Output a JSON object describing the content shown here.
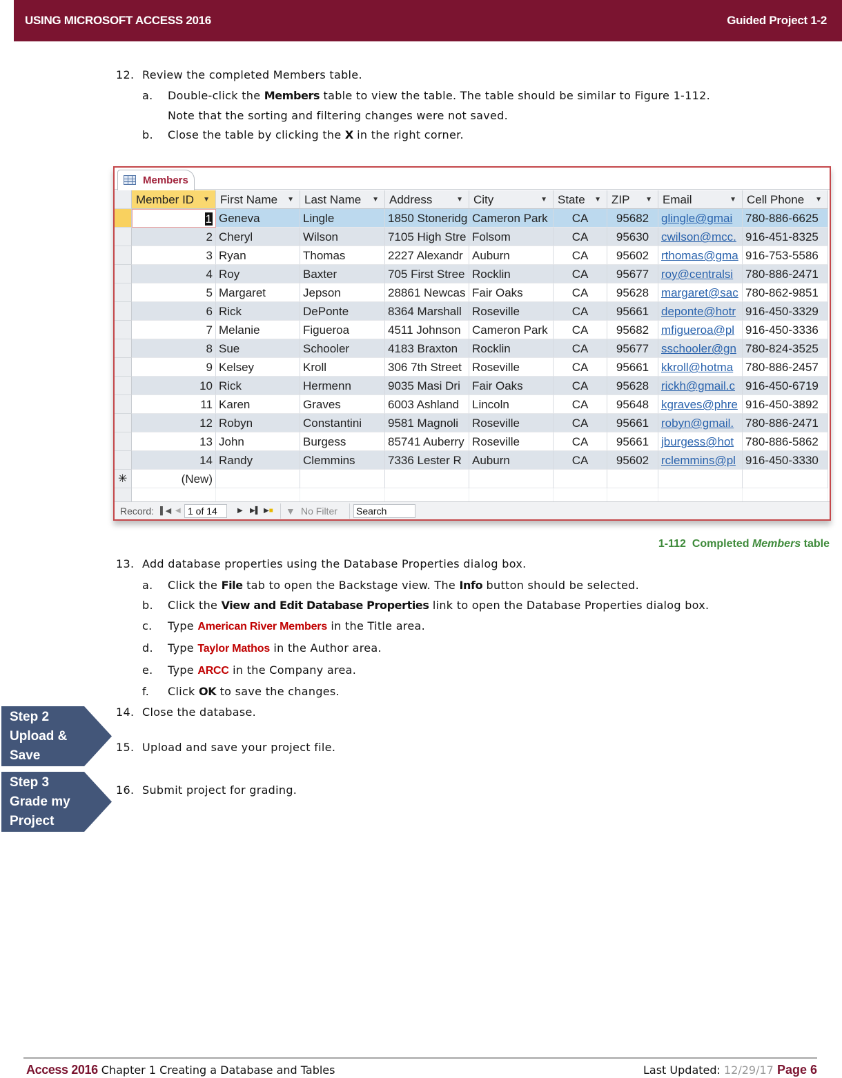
{
  "header": {
    "left": "USING MICROSOFT ACCESS 2016",
    "right": "Guided Project 1-2"
  },
  "steps": {
    "s12": {
      "num": "12.",
      "text": "Review the completed Members table.",
      "a": {
        "letter": "a.",
        "pre": "Double-click the ",
        "bold": "Members",
        "post": " table to view the table. The table should be similar to Figure 1-112.",
        "line2": "Note that the sorting and filtering changes were not saved."
      },
      "b": {
        "letter": "b.",
        "pre": "Close the table by clicking the ",
        "bold": "X",
        "post": " in the right corner."
      }
    },
    "s13": {
      "num": "13.",
      "text": "Add database properties using the Database Properties dialog box.",
      "a": {
        "letter": "a.",
        "pre": "Click the ",
        "bold1": "File",
        "mid": " tab to open the Backstage view. The ",
        "bold2": "Info",
        "post": " button should be selected."
      },
      "b": {
        "letter": "b.",
        "pre": "Click the ",
        "bold": "View and Edit Database Properties",
        "post": " link to open the Database Properties dialog box."
      },
      "c": {
        "letter": "c.",
        "pre": "Type ",
        "typed": "American River Members",
        "post": " in the Title area."
      },
      "d": {
        "letter": "d.",
        "pre": "Type ",
        "typed": "Taylor Mathos",
        "post": " in the Author area."
      },
      "e": {
        "letter": "e.",
        "pre": "Type ",
        "typed": "ARCC",
        "post": " in the Company area."
      },
      "f": {
        "letter": "f.",
        "pre": "Click ",
        "bold": "OK",
        "post": " to save the changes."
      }
    },
    "s14": {
      "num": "14.",
      "text": "Close the database."
    },
    "s15": {
      "num": "15.",
      "text": "Upload and save your project file."
    },
    "s16": {
      "num": "16.",
      "text": "Submit project for grading."
    }
  },
  "figure": {
    "tab_label": "Members",
    "columns": [
      "Member ID",
      "First Name",
      "Last Name",
      "Address",
      "City",
      "State",
      "ZIP",
      "Email",
      "Cell Phone"
    ],
    "rows": [
      [
        "1",
        "Geneva",
        "Lingle",
        "1850 Stoneridg",
        "Cameron Park",
        "CA",
        "95682",
        "glingle@gmai",
        "780-886-6625"
      ],
      [
        "2",
        "Cheryl",
        "Wilson",
        "7105 High Stre",
        "Folsom",
        "CA",
        "95630",
        "cwilson@mcc.",
        "916-451-8325"
      ],
      [
        "3",
        "Ryan",
        "Thomas",
        "2227 Alexandr",
        "Auburn",
        "CA",
        "95602",
        "rthomas@gma",
        "916-753-5586"
      ],
      [
        "4",
        "Roy",
        "Baxter",
        "705 First Stree",
        "Rocklin",
        "CA",
        "95677",
        "roy@centralsi",
        "780-886-2471"
      ],
      [
        "5",
        "Margaret",
        "Jepson",
        "28861 Newcas",
        "Fair Oaks",
        "CA",
        "95628",
        "margaret@sac",
        "780-862-9851"
      ],
      [
        "6",
        "Rick",
        "DePonte",
        "8364 Marshall",
        "Roseville",
        "CA",
        "95661",
        "deponte@hotr",
        "916-450-3329"
      ],
      [
        "7",
        "Melanie",
        "Figueroa",
        "4511 Johnson",
        "Cameron Park",
        "CA",
        "95682",
        "mfigueroa@pl",
        "916-450-3336"
      ],
      [
        "8",
        "Sue",
        "Schooler",
        "4183 Braxton",
        "Rocklin",
        "CA",
        "95677",
        "sschooler@gn",
        "780-824-3525"
      ],
      [
        "9",
        "Kelsey",
        "Kroll",
        "306 7th Street",
        "Roseville",
        "CA",
        "95661",
        "kkroll@hotma",
        "780-886-2457"
      ],
      [
        "10",
        "Rick",
        "Hermenn",
        "9035 Masi Dri",
        "Fair Oaks",
        "CA",
        "95628",
        "rickh@gmail.c",
        "916-450-6719"
      ],
      [
        "11",
        "Karen",
        "Graves",
        "6003 Ashland",
        "Lincoln",
        "CA",
        "95648",
        "kgraves@phre",
        "916-450-3892"
      ],
      [
        "12",
        "Robyn",
        "Constantini",
        "9581 Magnoli",
        "Roseville",
        "CA",
        "95661",
        "robyn@gmail.",
        "780-886-2471"
      ],
      [
        "13",
        "John",
        "Burgess",
        "85741 Auberry",
        "Roseville",
        "CA",
        "95661",
        "jburgess@hot",
        "780-886-5862"
      ],
      [
        "14",
        "Randy",
        "Clemmins",
        "7336 Lester R",
        "Auburn",
        "CA",
        "95602",
        "rclemmins@pl",
        "916-450-3330"
      ]
    ],
    "new_row_label": "(New)",
    "status": {
      "record_label": "Record:",
      "record_value": "1 of 14",
      "filter_label": "No Filter",
      "search_placeholder": "Search"
    },
    "caption_num": "1-112",
    "caption_pre": "Completed ",
    "caption_italic": "Members",
    "caption_post": " table"
  },
  "arrows": [
    {
      "lines": [
        "Step 2",
        "Upload &",
        "Save"
      ],
      "color": "#435679"
    },
    {
      "lines": [
        "Step 3",
        "Grade my",
        "Project"
      ],
      "color": "#435679"
    }
  ],
  "footer": {
    "brand": "Access 2016",
    "chapter": " Chapter 1 Creating a Database and Tables",
    "updated_label": "Last Updated: ",
    "updated_date": "12/29/17",
    "page": "Page 6"
  },
  "colors": {
    "header_bg": "#7b1430",
    "typed_text": "#c00000",
    "caption": "#3e8a3a",
    "arrow_bg": "#435679"
  }
}
